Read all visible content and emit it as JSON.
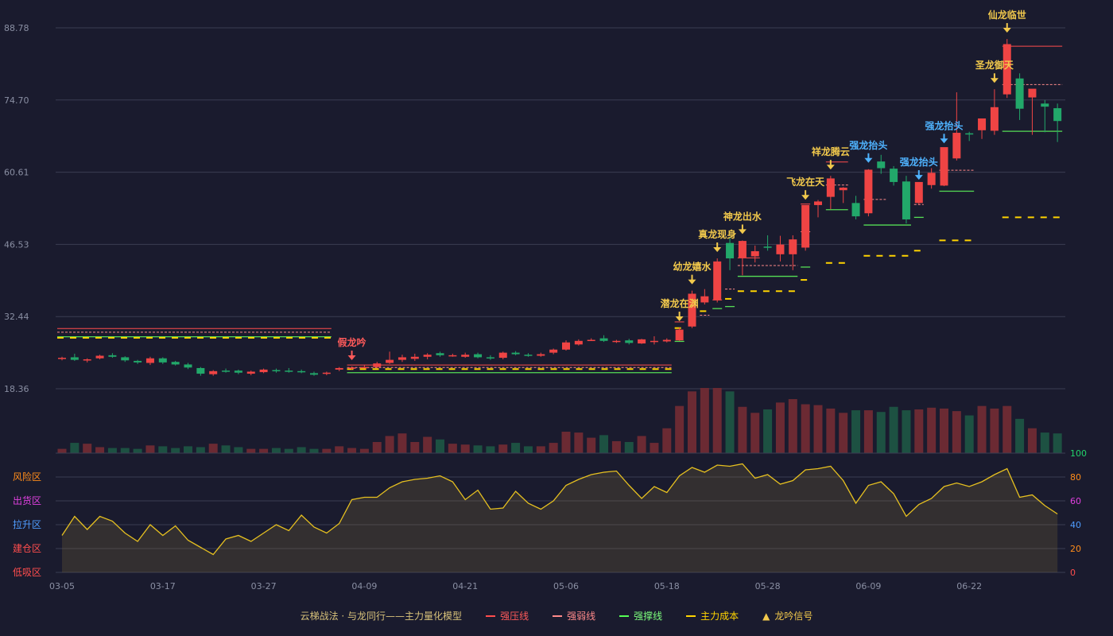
{
  "legend": {
    "title": "云梯战法 · 与龙同行——主力量化模型",
    "items": [
      {
        "label": "强压线",
        "color": "#ff4d4d",
        "style": "solid",
        "text_color": "#ff5a5a"
      },
      {
        "label": "强弱线",
        "color": "#ff8a8a",
        "style": "dashed",
        "text_color": "#ff8a8a"
      },
      {
        "label": "强撑线",
        "color": "#55ff55",
        "style": "solid",
        "text_color": "#7dff7d"
      },
      {
        "label": "主力成本",
        "color": "#ffd400",
        "style": "dashed",
        "text_color": "#ffd400"
      },
      {
        "label": "龙吟信号",
        "color": "#f2c94c",
        "style": "triangle",
        "text_color": "#f2c94c"
      }
    ]
  },
  "colors": {
    "background": "#1a1b2e",
    "up": "#ef4444",
    "down": "#22a86a",
    "grid": "#3a3d52",
    "osc_line": "#e6c020",
    "vol_up": "#6b2a33",
    "vol_down": "#1d5142",
    "signal_gold": "#f2c94c",
    "signal_blue": "#4fb3ff",
    "signal_red": "#ff5a5a"
  },
  "chart_data": [
    {
      "type": "candlestick",
      "y_ticks": [
        "88.78",
        "74.70",
        "60.61",
        "46.53",
        "32.44",
        "18.36"
      ],
      "ylim": [
        18.36,
        88.78
      ],
      "x_ticks": [
        {
          "index": 0,
          "label": "03-05"
        },
        {
          "index": 8,
          "label": "03-17"
        },
        {
          "index": 16,
          "label": "03-27"
        },
        {
          "index": 24,
          "label": "04-09"
        },
        {
          "index": 32,
          "label": "04-21"
        },
        {
          "index": 40,
          "label": "05-06"
        },
        {
          "index": 48,
          "label": "05-18"
        },
        {
          "index": 56,
          "label": "05-28"
        },
        {
          "index": 64,
          "label": "06-09"
        },
        {
          "index": 72,
          "label": "06-22"
        }
      ],
      "ohlc": [
        [
          24.2,
          24.6,
          23.9,
          24.4
        ],
        [
          24.5,
          25.2,
          23.8,
          24.0
        ],
        [
          24.0,
          24.3,
          23.5,
          24.1
        ],
        [
          24.3,
          25.0,
          24.1,
          24.8
        ],
        [
          24.9,
          25.3,
          24.4,
          24.6
        ],
        [
          24.5,
          24.7,
          23.6,
          23.9
        ],
        [
          23.8,
          24.0,
          23.2,
          23.5
        ],
        [
          23.4,
          24.6,
          23.0,
          24.3
        ],
        [
          24.3,
          24.5,
          23.2,
          23.5
        ],
        [
          23.6,
          23.8,
          22.9,
          23.1
        ],
        [
          23.1,
          23.4,
          22.2,
          22.5
        ],
        [
          22.4,
          22.6,
          20.9,
          21.3
        ],
        [
          21.2,
          22.0,
          20.9,
          21.8
        ],
        [
          21.9,
          22.3,
          21.5,
          21.8
        ],
        [
          21.9,
          22.1,
          21.2,
          21.5
        ],
        [
          21.3,
          21.9,
          21.0,
          21.7
        ],
        [
          21.6,
          22.3,
          21.4,
          22.1
        ],
        [
          22.0,
          22.3,
          21.5,
          21.8
        ],
        [
          21.9,
          22.4,
          21.5,
          21.8
        ],
        [
          21.8,
          22.1,
          21.4,
          21.6
        ],
        [
          21.4,
          21.7,
          20.9,
          21.1
        ],
        [
          21.3,
          21.7,
          21.0,
          21.5
        ],
        [
          22.1,
          22.6,
          21.8,
          22.4
        ],
        [
          22.4,
          22.7,
          22.1,
          22.5
        ],
        [
          22.5,
          23.0,
          22.3,
          22.6
        ],
        [
          22.6,
          23.6,
          22.3,
          23.3
        ],
        [
          23.4,
          25.6,
          23.2,
          24.0
        ],
        [
          24.0,
          25.0,
          23.6,
          24.5
        ],
        [
          24.2,
          25.2,
          23.8,
          24.6
        ],
        [
          24.6,
          25.3,
          24.1,
          25.0
        ],
        [
          25.3,
          25.6,
          24.6,
          24.9
        ],
        [
          24.9,
          25.2,
          24.6,
          24.9
        ],
        [
          24.6,
          25.4,
          24.4,
          25.0
        ],
        [
          25.1,
          25.4,
          24.3,
          24.5
        ],
        [
          24.5,
          24.9,
          24.0,
          24.3
        ],
        [
          24.4,
          25.6,
          24.1,
          25.4
        ],
        [
          25.4,
          25.7,
          24.9,
          25.1
        ],
        [
          25.0,
          25.3,
          24.6,
          24.8
        ],
        [
          24.8,
          25.4,
          24.6,
          25.1
        ],
        [
          25.4,
          26.2,
          25.1,
          26.0
        ],
        [
          26.0,
          27.8,
          25.8,
          27.4
        ],
        [
          27.0,
          28.0,
          26.8,
          27.7
        ],
        [
          27.9,
          28.2,
          27.7,
          27.9
        ],
        [
          28.2,
          28.8,
          27.5,
          27.7
        ],
        [
          27.5,
          27.9,
          27.3,
          27.7
        ],
        [
          27.8,
          28.1,
          27.0,
          27.3
        ],
        [
          27.2,
          28.1,
          27.1,
          28.0
        ],
        [
          27.6,
          28.6,
          27.0,
          27.7
        ],
        [
          27.6,
          28.2,
          27.4,
          27.9
        ],
        [
          27.8,
          30.3,
          27.7,
          29.9
        ],
        [
          30.5,
          37.5,
          30.2,
          36.9
        ],
        [
          35.2,
          37.8,
          34.8,
          36.4
        ],
        [
          35.6,
          43.8,
          35.2,
          43.2
        ],
        [
          46.8,
          47.8,
          41.5,
          43.8
        ],
        [
          43.9,
          47.3,
          40.5,
          47.2
        ],
        [
          44.2,
          46.3,
          43.0,
          45.2
        ],
        [
          46.1,
          48.3,
          45.3,
          46.0
        ],
        [
          44.6,
          48.2,
          43.2,
          46.5
        ],
        [
          44.6,
          48.3,
          41.5,
          47.5
        ],
        [
          45.9,
          54.0,
          45.3,
          54.2
        ],
        [
          54.2,
          55.2,
          51.8,
          54.9
        ],
        [
          55.8,
          59.9,
          53.4,
          59.4
        ],
        [
          57.1,
          57.7,
          54.6,
          57.6
        ],
        [
          54.6,
          56.0,
          51.4,
          52.0
        ],
        [
          52.6,
          61.2,
          52.0,
          61.1
        ],
        [
          62.7,
          64.0,
          60.3,
          61.4
        ],
        [
          61.3,
          61.8,
          58.0,
          58.7
        ],
        [
          58.8,
          59.9,
          50.6,
          51.4
        ],
        [
          54.6,
          57.9,
          54.4,
          58.7
        ],
        [
          58.1,
          61.4,
          57.4,
          60.5
        ],
        [
          58.0,
          65.0,
          57.9,
          65.5
        ],
        [
          63.3,
          76.2,
          62.9,
          68.3
        ],
        [
          68.2,
          68.5,
          66.7,
          68.0
        ],
        [
          68.8,
          69.8,
          67.1,
          71.1
        ],
        [
          68.7,
          76.8,
          67.9,
          73.3
        ],
        [
          75.8,
          86.6,
          75.1,
          85.6
        ],
        [
          78.9,
          79.9,
          70.8,
          73.0
        ],
        [
          75.2,
          76.6,
          67.9,
          76.9
        ],
        [
          74.0,
          74.7,
          68.4,
          73.4
        ],
        [
          73.1,
          74.0,
          66.5,
          70.6
        ]
      ],
      "levels": [
        {
          "kind": "resistance",
          "start": 0,
          "end": 21,
          "value": 30.1
        },
        {
          "kind": "strength",
          "start": 0,
          "end": 21,
          "value": 29.4
        },
        {
          "kind": "support",
          "start": 0,
          "end": 21,
          "value": 28.5
        },
        {
          "kind": "cost",
          "start": 0,
          "end": 21,
          "value": 28.3
        },
        {
          "kind": "resistance",
          "start": 23,
          "end": 48,
          "value": 23.0
        },
        {
          "kind": "strength",
          "start": 23,
          "end": 48,
          "value": 22.5
        },
        {
          "kind": "support",
          "start": 23,
          "end": 48,
          "value": 21.5
        },
        {
          "kind": "cost",
          "start": 23,
          "end": 48,
          "value": 22.2
        },
        {
          "kind": "resistance",
          "start": 49,
          "end": 49,
          "value": 31.4
        },
        {
          "kind": "cost",
          "start": 49,
          "end": 49,
          "value": 30.2
        },
        {
          "kind": "support",
          "start": 49,
          "end": 49,
          "value": 27.6
        },
        {
          "kind": "strength",
          "start": 51,
          "end": 51,
          "value": 32.7
        },
        {
          "kind": "cost",
          "start": 51,
          "end": 51,
          "value": 33.5
        },
        {
          "kind": "resistance",
          "start": 52,
          "end": 52,
          "value": 35.7
        },
        {
          "kind": "support",
          "start": 52,
          "end": 52,
          "value": 34.0
        },
        {
          "kind": "strength",
          "start": 53,
          "end": 53,
          "value": 37.8
        },
        {
          "kind": "cost",
          "start": 53,
          "end": 53,
          "value": 35.9
        },
        {
          "kind": "support",
          "start": 53,
          "end": 53,
          "value": 34.4
        },
        {
          "kind": "resistance",
          "start": 54,
          "end": 55,
          "value": 43.9
        },
        {
          "kind": "strength",
          "start": 54,
          "end": 58,
          "value": 42.4
        },
        {
          "kind": "support",
          "start": 54,
          "end": 58,
          "value": 40.3
        },
        {
          "kind": "cost",
          "start": 54,
          "end": 58,
          "value": 37.4
        },
        {
          "kind": "resistance",
          "start": 59,
          "end": 59,
          "value": 54.4
        },
        {
          "kind": "strength",
          "start": 59,
          "end": 59,
          "value": 49.0
        },
        {
          "kind": "support",
          "start": 59,
          "end": 59,
          "value": 42.1
        },
        {
          "kind": "cost",
          "start": 59,
          "end": 59,
          "value": 39.6
        },
        {
          "kind": "resistance",
          "start": 61,
          "end": 62,
          "value": 62.6
        },
        {
          "kind": "strength",
          "start": 61,
          "end": 62,
          "value": 58.1
        },
        {
          "kind": "support",
          "start": 61,
          "end": 62,
          "value": 53.3
        },
        {
          "kind": "cost",
          "start": 61,
          "end": 62,
          "value": 42.9
        },
        {
          "kind": "strength",
          "start": 64,
          "end": 65,
          "value": 55.3
        },
        {
          "kind": "support",
          "start": 64,
          "end": 67,
          "value": 50.3
        },
        {
          "kind": "cost",
          "start": 64,
          "end": 67,
          "value": 44.3
        },
        {
          "kind": "strength",
          "start": 68,
          "end": 68,
          "value": 54.3
        },
        {
          "kind": "support",
          "start": 68,
          "end": 68,
          "value": 51.8
        },
        {
          "kind": "cost",
          "start": 68,
          "end": 68,
          "value": 45.3
        },
        {
          "kind": "strength",
          "start": 70,
          "end": 72,
          "value": 61.0
        },
        {
          "kind": "support",
          "start": 70,
          "end": 72,
          "value": 56.9
        },
        {
          "kind": "cost",
          "start": 70,
          "end": 72,
          "value": 47.3
        },
        {
          "kind": "resistance",
          "start": 75,
          "end": 79,
          "value": 85.2
        },
        {
          "kind": "strength",
          "start": 75,
          "end": 79,
          "value": 77.7
        },
        {
          "kind": "support",
          "start": 75,
          "end": 79,
          "value": 68.6
        },
        {
          "kind": "cost",
          "start": 75,
          "end": 79,
          "value": 51.8
        }
      ],
      "signals": [
        {
          "index": 23,
          "label": "假龙吟",
          "color": "red"
        },
        {
          "index": 49,
          "label": "潜龙在渊",
          "color": "gold"
        },
        {
          "index": 50,
          "label": "幼龙嬉水",
          "color": "gold"
        },
        {
          "index": 52,
          "label": "真龙现身",
          "color": "gold"
        },
        {
          "index": 54,
          "label": "神龙出水",
          "color": "gold"
        },
        {
          "index": 59,
          "label": "飞龙在天",
          "color": "gold"
        },
        {
          "index": 61,
          "label": "祥龙腾云",
          "color": "gold"
        },
        {
          "index": 64,
          "label": "强龙抬头",
          "color": "blue"
        },
        {
          "index": 68,
          "label": "强龙抬头",
          "color": "blue"
        },
        {
          "index": 70,
          "label": "强龙抬头",
          "color": "blue"
        },
        {
          "index": 74,
          "label": "圣龙御天",
          "color": "gold"
        },
        {
          "index": 75,
          "label": "仙龙临世",
          "color": "gold"
        }
      ]
    },
    {
      "type": "bar",
      "name": "volume",
      "values": [
        5,
        12,
        11,
        7,
        6,
        6,
        5,
        9,
        8,
        6,
        8,
        7,
        11,
        9,
        7,
        5,
        5,
        6,
        5,
        7,
        5,
        5,
        8,
        6,
        5,
        13,
        20,
        23,
        13,
        19,
        16,
        11,
        10,
        9,
        8,
        10,
        12,
        8,
        8,
        12,
        25,
        24,
        18,
        21,
        14,
        13,
        20,
        12,
        29,
        55,
        72,
        76,
        76,
        72,
        54,
        47,
        51,
        59,
        63,
        57,
        56,
        52,
        47,
        50,
        50,
        48,
        54,
        50,
        51,
        53,
        52,
        49,
        44,
        55,
        52,
        55,
        40,
        29,
        24,
        23
      ]
    },
    {
      "type": "area",
      "name": "oscillator",
      "ylim": [
        0,
        100
      ],
      "y_ticks": [
        {
          "value": 100,
          "label": "100",
          "color": "#22d36a"
        },
        {
          "value": 80,
          "label": "80",
          "color": "#ff8c1a"
        },
        {
          "value": 60,
          "label": "60",
          "color": "#e040e0"
        },
        {
          "value": 40,
          "label": "40",
          "color": "#4f9dff"
        },
        {
          "value": 20,
          "label": "20",
          "color": "#ff8c1a"
        },
        {
          "value": 0,
          "label": "0",
          "color": "#ff4d4d"
        }
      ],
      "zones": [
        {
          "label": "风险区",
          "color": "#ff8c1a"
        },
        {
          "label": "出货区",
          "color": "#e040e0"
        },
        {
          "label": "拉升区",
          "color": "#4f9dff"
        },
        {
          "label": "建仓区",
          "color": "#ff4d4d"
        },
        {
          "label": "低吸区",
          "color": "#ff4d4d"
        }
      ],
      "values": [
        31,
        47,
        36,
        47,
        43,
        33,
        26,
        40,
        31,
        39,
        27,
        21,
        15,
        28,
        31,
        26,
        33,
        40,
        35,
        48,
        38,
        33,
        41,
        61,
        63,
        63,
        71,
        76,
        78,
        79,
        81,
        76,
        61,
        69,
        53,
        54,
        68,
        58,
        53,
        60,
        73,
        78,
        82,
        84,
        85,
        73,
        62,
        72,
        67,
        81,
        88,
        84,
        90,
        89,
        91,
        79,
        82,
        74,
        77,
        86,
        87,
        89,
        77,
        58,
        73,
        76,
        66,
        47,
        57,
        62,
        72,
        75,
        72,
        76,
        82,
        87,
        63,
        65,
        56,
        49
      ]
    }
  ]
}
